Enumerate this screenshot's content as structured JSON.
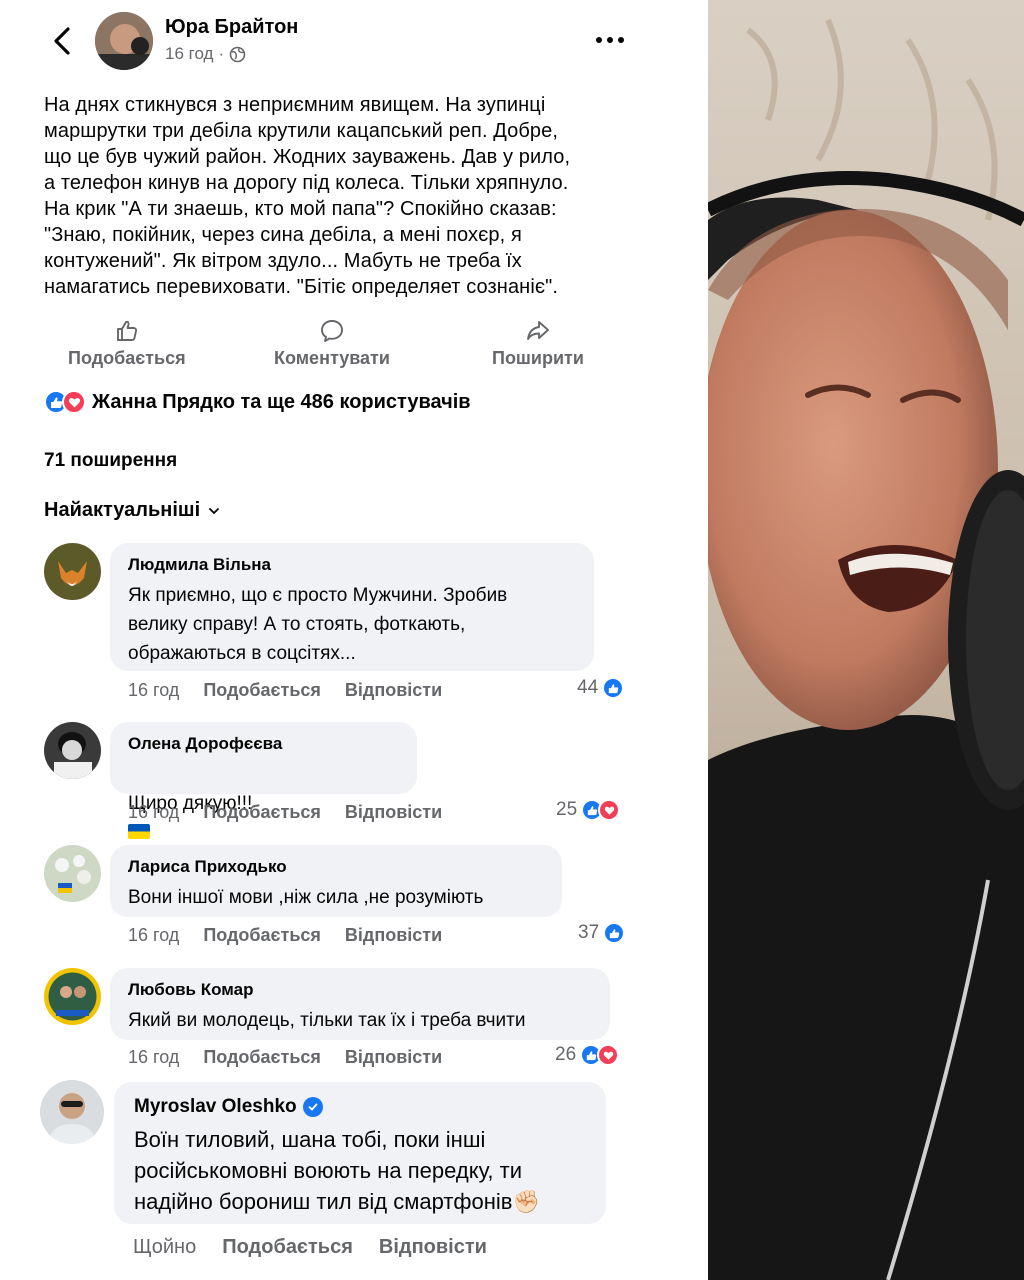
{
  "post": {
    "author": "Юра Брайтон",
    "time": "16 год",
    "separator": "·",
    "text": "На днях стикнувся з неприємним явищем. На зупинці\nмаршрутки три дебіла крутили кацапський реп. Добре,\nщо це був чужий район. Жодних зауважень. Дав у рило,\nа телефон кинув на дорогу під колеса. Тільки хряпнуло.\nНа крик \"А ти знаешь, кто мой папа\"? Спокійно сказав:\n\"Знаю, покійник, через сина дебіла, а мені похєр, я\nконтужений\". Як вітром здуло... Мабуть не треба їх\nнамагатись перевиховати. \"Бітіє определяет сознаніє\"."
  },
  "actions": {
    "like": "Подобається",
    "comment": "Коментувати",
    "share": "Поширити"
  },
  "reactions_summary": "Жанна Прядко та ще 486 користувачів",
  "shares": "71 поширення",
  "sort_label": "Найактуальніші",
  "comments": [
    {
      "name": "Людмила Вільна",
      "text": "Як приємно, що є просто Мужчини. Зробив\nвелику справу! А то стоять, фоткають,\nображаються в соцсітях...",
      "time": "16 год",
      "like": "Подобається",
      "reply": "Відповісти",
      "count": "44",
      "reactions": [
        "like"
      ]
    },
    {
      "name": "Олена Дорофєєва",
      "text": "Щиро дякую!!!",
      "emojis": [
        "❤️",
        "💛",
        "💙"
      ],
      "time": "16 год",
      "like": "Подобається",
      "reply": "Відповісти",
      "count": "25",
      "reactions": [
        "like",
        "love"
      ]
    },
    {
      "name": "Лариса Приходько",
      "text": "Вони іншої мови ,ніж сила ,не розуміють",
      "time": "16 год",
      "like": "Подобається",
      "reply": "Відповісти",
      "count": "37",
      "reactions": [
        "like"
      ]
    },
    {
      "name": "Любовь Комар",
      "text": "Який ви молодець, тільки так їх і треба вчити",
      "time": "16 год",
      "like": "Подобається",
      "reply": "Відповісти",
      "count": "26",
      "reactions": [
        "like",
        "love"
      ]
    },
    {
      "name": "Myroslav Oleshko",
      "verified": true,
      "text": "Воїн тиловий, шана тобі, поки інші\nросійськомовні воюють на передку, ти\nнадійно борониш тил від смартфонів",
      "emoji_end": "✊🏻",
      "time": "Щойно",
      "like": "Подобається",
      "reply": "Відповісти"
    }
  ],
  "colors": {
    "secondary_text": "#65676b",
    "bubble": "#f0f2f5",
    "like_blue": "#1877f2",
    "love_red": "#f33e58"
  }
}
